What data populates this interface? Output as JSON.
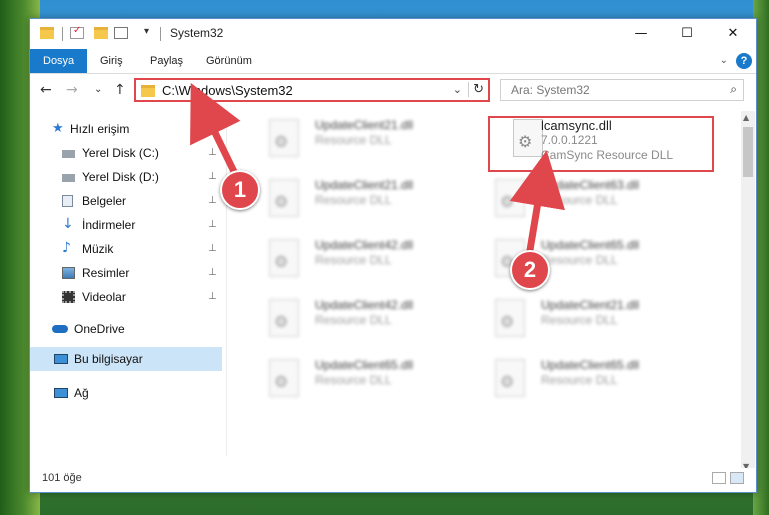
{
  "window": {
    "title": "System32",
    "minimize": "—",
    "maximize": "☐",
    "close": "✕"
  },
  "ribbon": {
    "tabs": [
      "Dosya",
      "Giriş",
      "Paylaş",
      "Görünüm"
    ],
    "help": "?"
  },
  "nav": {
    "back": "←",
    "forward": "→",
    "recent": "⌄",
    "up": "↑",
    "address": "C:\\Windows\\System32",
    "dropdown": "⌄",
    "refresh": "↻",
    "search_placeholder": "Ara: System32",
    "search_icon": "⌕"
  },
  "sidebar": {
    "items": [
      {
        "label": "Hızlı erişim",
        "icon": "star-icon",
        "pinned": false
      },
      {
        "label": "Yerel Disk (C:)",
        "icon": "drive-icon",
        "pinned": true
      },
      {
        "label": "Yerel Disk (D:)",
        "icon": "drive-icon",
        "pinned": true
      },
      {
        "label": "Belgeler",
        "icon": "documents-icon",
        "pinned": true
      },
      {
        "label": "İndirmeler",
        "icon": "download-icon",
        "pinned": true
      },
      {
        "label": "Müzik",
        "icon": "music-icon",
        "pinned": true
      },
      {
        "label": "Resimler",
        "icon": "pictures-icon",
        "pinned": true
      },
      {
        "label": "Videolar",
        "icon": "videos-icon",
        "pinned": true
      },
      {
        "label": "OneDrive",
        "icon": "cloud-icon",
        "pinned": false
      },
      {
        "label": "Bu bilgisayar",
        "icon": "computer-icon",
        "pinned": false
      },
      {
        "label": "Ağ",
        "icon": "network-icon",
        "pinned": false
      }
    ],
    "pin_glyph": "📌"
  },
  "files": {
    "highlighted": {
      "name": "lcamsync.dll",
      "version": "7.0.0.1221",
      "description": "CamSync Resource DLL"
    },
    "left_column": [
      {
        "name": "UpdateClient21.dll",
        "description": "Resource DLL"
      },
      {
        "name": "UpdateClient21.dll",
        "description": "Resource DLL"
      },
      {
        "name": "UpdateClient42.dll",
        "description": "Resource DLL"
      },
      {
        "name": "UpdateClient42.dll",
        "description": "Resource DLL"
      },
      {
        "name": "UpdateClient65.dll",
        "description": "Resource DLL"
      }
    ],
    "right_column": [
      {
        "name": "UpdateClient63.dll",
        "description": "Resource DLL"
      },
      {
        "name": "UpdateClient65.dll",
        "description": "Resource DLL"
      },
      {
        "name": "UpdateClient21.dll",
        "description": "Resource DLL"
      },
      {
        "name": "UpdateClient65.dll",
        "description": "Resource DLL"
      }
    ]
  },
  "status": {
    "count": "101 öğe"
  },
  "callouts": {
    "one": "1",
    "two": "2"
  },
  "colors": {
    "accent": "#1979ca",
    "callout": "#e0474c"
  }
}
